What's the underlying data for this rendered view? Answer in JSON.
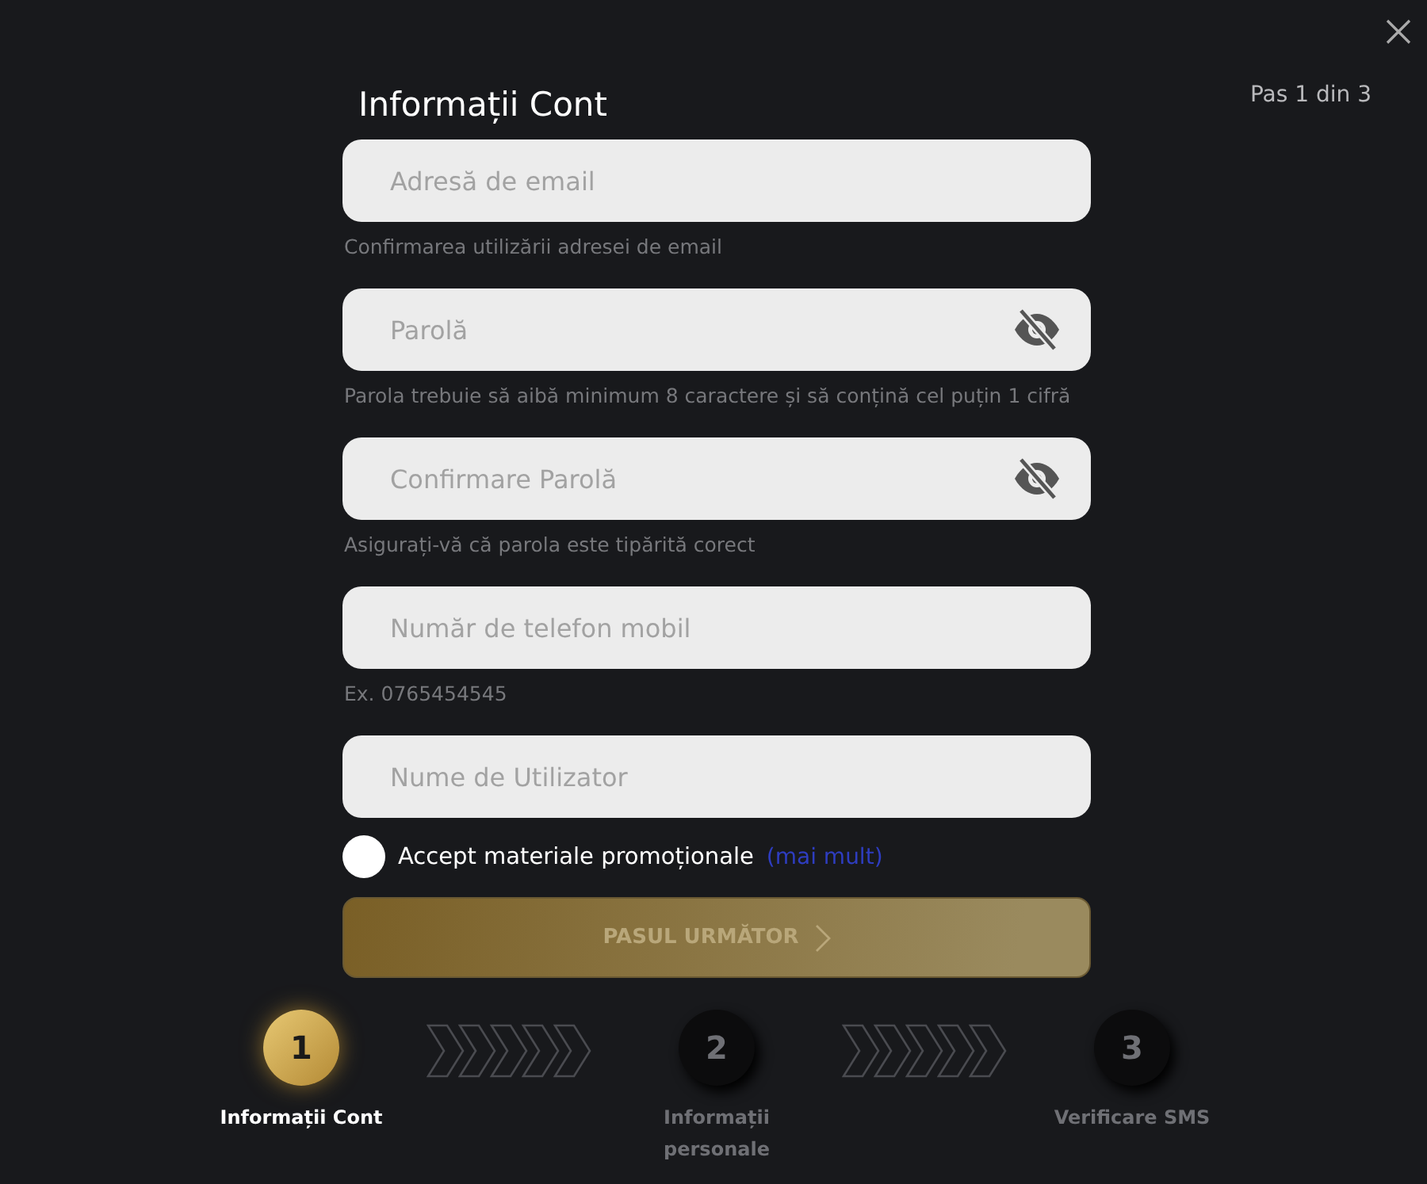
{
  "title": "Informații Cont",
  "step_counter": "Pas 1 din 3",
  "fields": [
    {
      "kind": "text",
      "placeholder": "Adresă de email",
      "hint": "Confirmarea utilizării adresei de email"
    },
    {
      "kind": "password",
      "placeholder": "Parolă",
      "hint": "Parola trebuie să aibă minimum 8 caractere și să conțină cel puțin 1 cifră"
    },
    {
      "kind": "password",
      "placeholder": "Confirmare Parolă",
      "hint": "Asigurați-vă că parola este tipărită corect"
    },
    {
      "kind": "text",
      "placeholder": "Număr de telefon mobil",
      "hint": "Ex. 0765454545"
    },
    {
      "kind": "text",
      "placeholder": "Nume de Utilizator"
    }
  ],
  "promo": {
    "label": "Accept materiale promoționale",
    "link": "(mai mult)",
    "checked": false
  },
  "next_button": "PASUL URMĂTOR",
  "steps": [
    {
      "number": "1",
      "label": "Informații Cont",
      "selected": true
    },
    {
      "number": "2",
      "label": "Informații personale",
      "selected": false
    },
    {
      "number": "3",
      "label": "Verificare SMS",
      "selected": false
    }
  ]
}
